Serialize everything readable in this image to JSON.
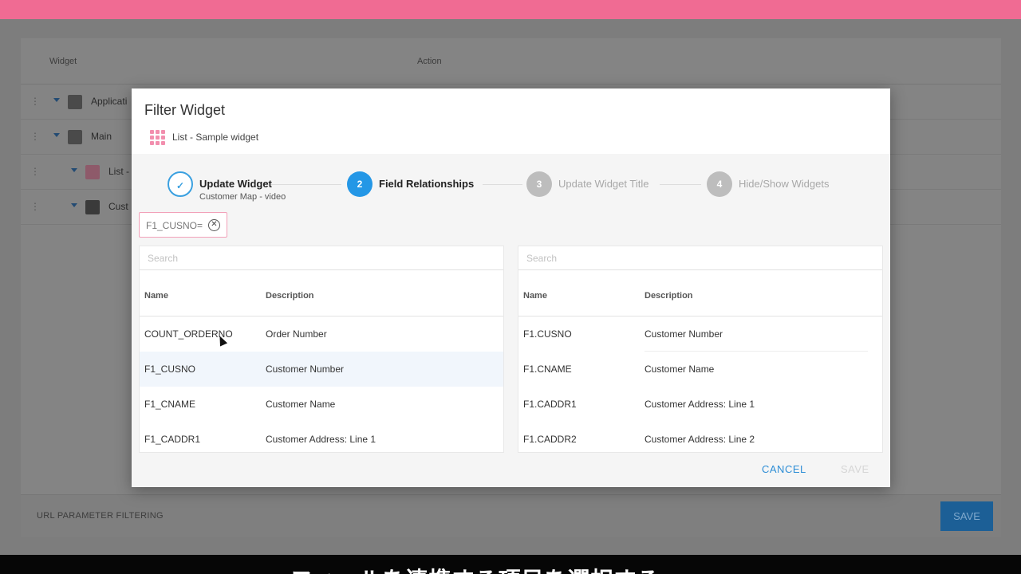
{
  "background": {
    "columns": {
      "widget": "Widget",
      "action": "Action"
    },
    "rows": [
      {
        "label": "Applicati",
        "icon": "document-icon"
      },
      {
        "label": "Main",
        "icon": "square-icon"
      },
      {
        "label": "List -",
        "icon": "grid-icon"
      },
      {
        "label": "Cust",
        "icon": "map-pin-icon"
      }
    ],
    "url_filtering": "URL PARAMETER FILTERING",
    "save_label": "SAVE"
  },
  "modal": {
    "title": "Filter Widget",
    "subtitle": "List - Sample widget",
    "steps": [
      {
        "number": "✓",
        "label": "Update Widget",
        "sub": "Customer Map - video",
        "state": "done"
      },
      {
        "number": "2",
        "label": "Field Relationships",
        "sub": "",
        "state": "active"
      },
      {
        "number": "3",
        "label": "Update Widget Title",
        "sub": "",
        "state": "off"
      },
      {
        "number": "4",
        "label": "Hide/Show Widgets",
        "sub": "",
        "state": "off"
      }
    ],
    "chip": {
      "text": "F1_CUSNO="
    },
    "left_panel": {
      "search_placeholder": "Search",
      "col_name": "Name",
      "col_desc": "Description",
      "rows": [
        {
          "name": "COUNT_ORDERNO",
          "desc": "Order Number"
        },
        {
          "name": "F1_CUSNO",
          "desc": "Customer Number"
        },
        {
          "name": "F1_CNAME",
          "desc": "Customer Name"
        },
        {
          "name": "F1_CADDR1",
          "desc": "Customer Address: Line 1"
        }
      ]
    },
    "right_panel": {
      "search_placeholder": "Search",
      "col_name": "Name",
      "col_desc": "Description",
      "rows": [
        {
          "name": "F1.CUSNO",
          "desc": "Customer Number"
        },
        {
          "name": "F1.CNAME",
          "desc": "Customer Name"
        },
        {
          "name": "F1.CADDR1",
          "desc": "Customer Address: Line 1"
        },
        {
          "name": "F1.CADDR2",
          "desc": "Customer Address: Line 2"
        }
      ]
    },
    "cancel_label": "CANCEL",
    "save_label": "SAVE"
  },
  "caption": "フィールを連携する項目を選択する"
}
